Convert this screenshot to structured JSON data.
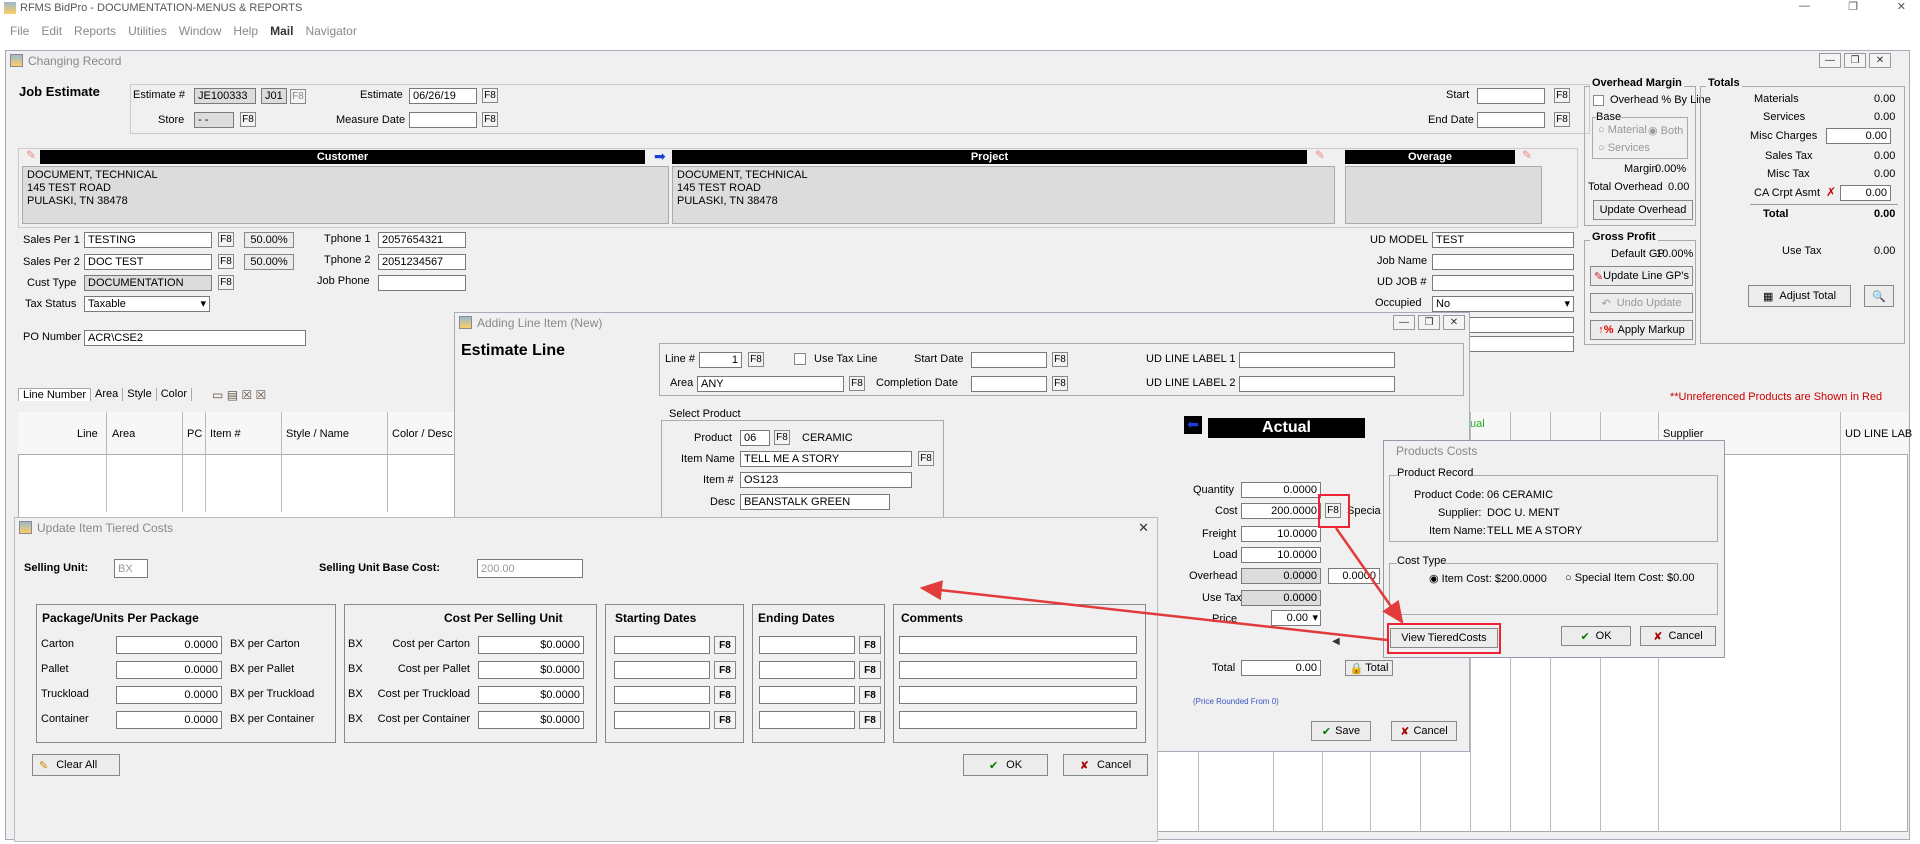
{
  "app": {
    "title": "RFMS BidPro - DOCUMENTATION-MENUS & REPORTS",
    "menu": [
      "File",
      "Edit",
      "Reports",
      "Utilities",
      "Window",
      "Help",
      "Mail",
      "Navigator"
    ]
  },
  "changing": {
    "title": "Changing Record",
    "heading": "Job Estimate",
    "estimate_label": "Estimate #",
    "estimate_value": "JE100333",
    "estimate_suffix": "J01",
    "estimate_date_label": "Estimate",
    "estimate_date": "06/26/19",
    "store_label": "Store",
    "store_value": "- -",
    "measure_label": "Measure Date",
    "start_label": "Start",
    "end_label": "End Date",
    "customer_hdr": "Customer",
    "project_hdr": "Project",
    "overage_hdr": "Overage",
    "customer_lines": [
      "DOCUMENT, TECHNICAL",
      "145 TEST ROAD",
      "PULASKI, TN 38478"
    ],
    "project_lines": [
      "DOCUMENT, TECHNICAL",
      "145 TEST ROAD",
      "PULASKI, TN 38478"
    ],
    "sales1_label": "Sales Per 1",
    "sales1": "TESTING",
    "sales1_pct": "50.00%",
    "sales2_label": "Sales Per 2",
    "sales2": "DOC TEST",
    "sales2_pct": "50.00%",
    "cust_type_label": "Cust Type",
    "cust_type": "DOCUMENTATION",
    "tax_label": "Tax Status",
    "tax": "Taxable",
    "po_label": "PO Number",
    "po": "ACR\\CSE2",
    "tphone1_label": "Tphone 1",
    "tphone1": "2057654321",
    "tphone2_label": "Tphone 2",
    "tphone2": "2051234567",
    "jobphone_label": "Job Phone",
    "udmodel_label": "UD MODEL",
    "udmodel": "TEST",
    "jobname_label": "Job Name",
    "udjob_label": "UD JOB #",
    "occupied_label": "Occupied",
    "occupied": "No",
    "tabs": [
      "Line Number",
      "Area",
      "Style",
      "Color"
    ],
    "unref": "**Unreferenced Products are Shown in Red",
    "grid_cols": [
      "Line",
      "Area",
      "PC",
      "Item #",
      "Style / Name",
      "Color / Desc"
    ],
    "supplier_col": "Supplier",
    "udline_col": "UD LINE LAB",
    "ual": "ual",
    "overhead_title": "Overhead Margin",
    "overhead_pct": "Overhead % By Line",
    "base": "Base",
    "material": "Material",
    "both": "Both",
    "services": "Services",
    "margin_label": "Margin",
    "margin": "0.00%",
    "total_overhead_label": "Total Overhead",
    "total_overhead": "0.00",
    "update_overhead": "Update Overhead",
    "gp_title": "Gross Profit",
    "default_gp_label": "Default GP",
    "default_gp": "10.00%",
    "update_gp": "Update Line GP's",
    "undo": "Undo Update",
    "markup": "Apply Markup",
    "totals_title": "Totals",
    "materials_label": "Materials",
    "materials": "0.00",
    "services_label": "Services",
    "services_val": "0.00",
    "misc_charges_label": "Misc Charges",
    "misc_charges": "0.00",
    "sales_tax_label": "Sales Tax",
    "sales_tax": "0.00",
    "misc_tax_label": "Misc Tax",
    "misc_tax": "0.00",
    "ca_label": "CA Crpt Asmt",
    "ca": "0.00",
    "total_label": "Total",
    "total": "0.00",
    "use_tax_label": "Use Tax",
    "use_tax": "0.00",
    "adjust_total": "Adjust Total"
  },
  "line": {
    "title": "Adding Line Item  (New)",
    "heading": "Estimate Line",
    "line_label": "Line #",
    "line": "1",
    "use_tax": "Use Tax Line",
    "start_label": "Start Date",
    "area_label": "Area",
    "area": "ANY",
    "completion_label": "Completion Date",
    "ud1": "UD LINE LABEL 1",
    "ud2": "UD LINE LABEL 2",
    "select_product": "Select Product",
    "product_label": "Product",
    "product": "06",
    "product_name": "CERAMIC",
    "itemname_label": "Item Name",
    "itemname": "TELL ME A STORY",
    "item_label": "Item #",
    "item": "OS123",
    "desc_label": "Desc",
    "desc": "BEANSTALK GREEN",
    "actual": "Actual",
    "qty_label": "Quantity",
    "qty": "0.0000",
    "cost_label": "Cost",
    "cost": "200.0000",
    "special": "Specia",
    "freight_label": "Freight",
    "freight": "10.0000",
    "load_label": "Load",
    "load": "10.0000",
    "overhead_label": "Overhead",
    "overhead": "0.0000",
    "overhead2": "0.0000",
    "usetax_label": "Use Tax",
    "usetax": "0.0000",
    "price_label": "Price",
    "price": "0.00",
    "total_label": "Total",
    "total": "0.00",
    "total_btn": "Total",
    "rounded": "(Price Rounded From 0)",
    "save": "Save",
    "cancel": "Cancel"
  },
  "products": {
    "title": "Products Costs",
    "record": "Product Record",
    "code_label": "Product Code:",
    "code": "06   CERAMIC",
    "supplier_label": "Supplier:",
    "supplier": "DOC U. MENT",
    "itemname_label": "Item Name:",
    "itemname": "TELL ME A STORY",
    "cost_type": "Cost Type",
    "item_cost": "Item Cost:  $200.0000",
    "special_cost": "Special Item Cost: $0.00",
    "view_tiered": "View TieredCosts",
    "ok": "OK",
    "cancel": "Cancel"
  },
  "tiered": {
    "title": "Update Item Tiered Costs",
    "selling_unit_label": "Selling Unit:",
    "selling_unit": "BX",
    "base_cost_label": "Selling Unit Base Cost:",
    "base_cost": "200.00",
    "pkg_hdr": "Package/Units Per Package",
    "cost_hdr": "Cost Per Selling Unit",
    "start_hdr": "Starting Dates",
    "end_hdr": "Ending Dates",
    "comments_hdr": "Comments",
    "rows": [
      {
        "name": "Carton",
        "qty": "0.0000",
        "per": "BX  per Carton",
        "unit": "BX",
        "cost_label": "Cost per Carton",
        "cost": "$0.0000"
      },
      {
        "name": "Pallet",
        "qty": "0.0000",
        "per": "BX  per Pallet",
        "unit": "BX",
        "cost_label": "Cost per Pallet",
        "cost": "$0.0000"
      },
      {
        "name": "Truckload",
        "qty": "0.0000",
        "per": "BX  per Truckload",
        "unit": "BX",
        "cost_label": "Cost per Truckload",
        "cost": "$0.0000"
      },
      {
        "name": "Container",
        "qty": "0.0000",
        "per": "BX  per Container",
        "unit": "BX",
        "cost_label": "Cost per Container",
        "cost": "$0.0000"
      }
    ],
    "clear_all": "Clear All",
    "ok": "OK",
    "cancel": "Cancel",
    "f8": "F8"
  },
  "colors": {
    "annotation": "#e23b3b",
    "black_header": "#000000",
    "red_note": "#cc0000"
  }
}
